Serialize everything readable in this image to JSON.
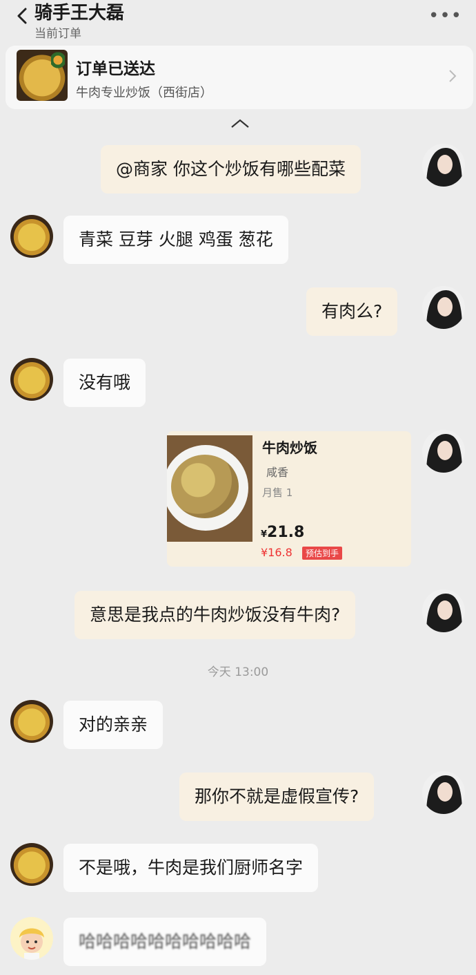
{
  "header": {
    "title": "骑手王大磊",
    "subtitle": "当前订单"
  },
  "order": {
    "status": "订单已送达",
    "shop": "牛肉专业炒饭（西街店）"
  },
  "messages": [
    {
      "from": "me",
      "text": "@商家 你这个炒饭有哪些配菜"
    },
    {
      "from": "merchant",
      "text": "青菜 豆芽 火腿 鸡蛋 葱花"
    },
    {
      "from": "me",
      "text": "有肉么?"
    },
    {
      "from": "merchant",
      "text": "没有哦"
    },
    {
      "from": "me",
      "text": "意思是我点的牛肉炒饭没有牛肉?"
    },
    {
      "from": "merchant",
      "text": "对的亲亲"
    },
    {
      "from": "me",
      "text": "那你不就是虚假宣传?"
    },
    {
      "from": "merchant",
      "text": "不是哦，牛肉是我们厨师名字"
    },
    {
      "from": "other",
      "text": "哈哈哈哈哈哈哈哈哈哈"
    }
  ],
  "product": {
    "name": "牛肉炒饭",
    "tag": "咸香",
    "sales": "月售 1",
    "currency": "¥",
    "price": "21.8",
    "discount_price": "¥16.8",
    "discount_badge": "预估到手"
  },
  "timestamp": "今天 13:00"
}
